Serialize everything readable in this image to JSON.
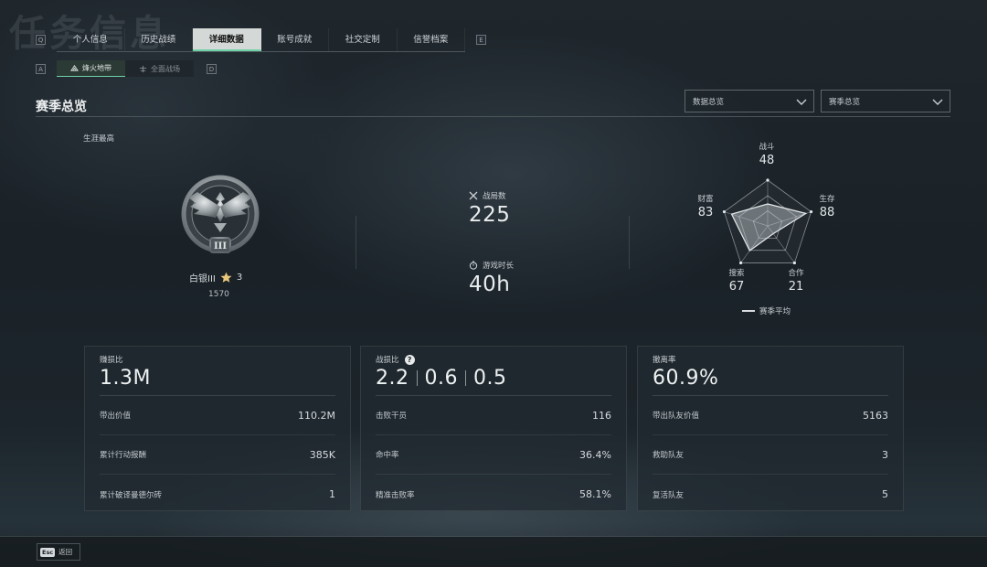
{
  "page_bg_title": "任务信息",
  "nav": {
    "left_key": "Q",
    "right_key": "E",
    "tabs": [
      {
        "label": "个人信息"
      },
      {
        "label": "历史战绩"
      },
      {
        "label": "详细数据",
        "active": true
      },
      {
        "label": "账号成就"
      },
      {
        "label": "社交定制"
      },
      {
        "label": "信誉档案"
      }
    ]
  },
  "subnav": {
    "left_key": "A",
    "right_key": "D",
    "tabs": [
      {
        "label": "烽火地带",
        "icon": "mode-extraction-icon",
        "active": true
      },
      {
        "label": "全面战场",
        "icon": "mode-warfare-icon"
      }
    ]
  },
  "section": {
    "title": "赛季总览",
    "dropdown_data": "数据总览",
    "dropdown_season": "赛季总览"
  },
  "career": {
    "label": "生涯最高",
    "rank_name": "白银III",
    "stars": "3",
    "points": "1570",
    "badge_tier": "III"
  },
  "stats": {
    "matches_label": "战局数",
    "matches_value": "225",
    "playtime_label": "游戏时长",
    "playtime_value": "40h"
  },
  "radar": {
    "axes": [
      {
        "label": "战斗",
        "value": "48"
      },
      {
        "label": "生存",
        "value": "88"
      },
      {
        "label": "合作",
        "value": "21"
      },
      {
        "label": "搜索",
        "value": "67"
      },
      {
        "label": "财富",
        "value": "83"
      }
    ],
    "legend": "赛季平均"
  },
  "cards": [
    {
      "title": "赚损比",
      "big": "1.3M",
      "rows": [
        {
          "label": "带出价值",
          "value": "110.2M"
        },
        {
          "label": "累计行动报酬",
          "value": "385K"
        },
        {
          "label": "累计破译曼德尔砖",
          "value": "1"
        }
      ]
    },
    {
      "title": "战损比",
      "big_parts": [
        "2.2",
        "0.6",
        "0.5"
      ],
      "rows": [
        {
          "label": "击败干员",
          "value": "116"
        },
        {
          "label": "命中率",
          "value": "36.4%"
        },
        {
          "label": "精准击败率",
          "value": "58.1%"
        }
      ]
    },
    {
      "title": "撤离率",
      "big": "60.9%",
      "rows": [
        {
          "label": "带出队友价值",
          "value": "5163"
        },
        {
          "label": "救助队友",
          "value": "3"
        },
        {
          "label": "复活队友",
          "value": "5"
        }
      ]
    }
  ],
  "footer": {
    "esc_key": "Esc",
    "back_label": "返回"
  }
}
